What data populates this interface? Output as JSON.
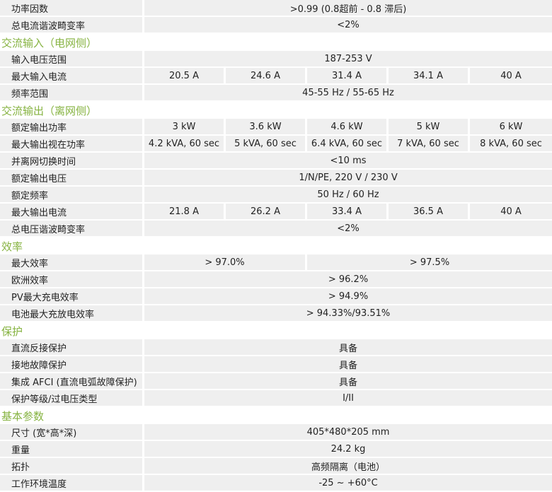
{
  "rows": [
    {
      "type": "row",
      "label": "功率因数",
      "values": [
        ">0.99 (0.8超前 - 0.8 滞后)"
      ]
    },
    {
      "type": "row",
      "label": "总电流谐波畸变率",
      "values": [
        "<2%"
      ]
    },
    {
      "type": "section",
      "title": "交流输入（电网侧）"
    },
    {
      "type": "row",
      "label": "输入电压范围",
      "values": [
        "187-253 V"
      ]
    },
    {
      "type": "row",
      "label": "最大输入电流",
      "values": [
        "20.5 A",
        "24.6 A",
        "31.4 A",
        "34.1 A",
        "40 A"
      ]
    },
    {
      "type": "row",
      "label": "频率范围",
      "values": [
        "45-55 Hz / 55-65 Hz"
      ]
    },
    {
      "type": "section",
      "title": "交流输出（离网侧）"
    },
    {
      "type": "row",
      "label": "额定输出功率",
      "values": [
        "3 kW",
        "3.6 kW",
        "4.6 kW",
        "5 kW",
        "6 kW"
      ]
    },
    {
      "type": "row",
      "label": "最大输出视在功率",
      "values": [
        "4.2 kVA, 60 sec",
        "5 kVA, 60 sec",
        "6.4 kVA, 60 sec",
        "7 kVA, 60 sec",
        "8 kVA, 60 sec"
      ]
    },
    {
      "type": "row",
      "label": "并离网切换时间",
      "values": [
        "<10 ms"
      ]
    },
    {
      "type": "row",
      "label": "额定输出电压",
      "values": [
        "1/N/PE, 220 V / 230 V"
      ]
    },
    {
      "type": "row",
      "label": "额定频率",
      "values": [
        "50 Hz / 60 Hz"
      ]
    },
    {
      "type": "row",
      "label": "最大输出电流",
      "values": [
        "21.8 A",
        "26.2 A",
        "33.4 A",
        "36.5 A",
        "40 A"
      ]
    },
    {
      "type": "row",
      "label": "总电压谐波畸变率",
      "values": [
        "<2%"
      ]
    },
    {
      "type": "section",
      "title": "效率"
    },
    {
      "type": "row",
      "label": "最大效率",
      "values": [
        "> 97.0%",
        "> 97.5%"
      ]
    },
    {
      "type": "row",
      "label": "欧洲效率",
      "values": [
        "> 96.2%"
      ]
    },
    {
      "type": "row",
      "label": "PV最大充电效率",
      "values": [
        "> 94.9%"
      ]
    },
    {
      "type": "row",
      "label": "电池最大充放电效率",
      "values": [
        "> 94.33%/93.51%"
      ]
    },
    {
      "type": "section",
      "title": "保护"
    },
    {
      "type": "row",
      "label": "直流反接保护",
      "values": [
        "具备"
      ]
    },
    {
      "type": "row",
      "label": "接地故障保护",
      "values": [
        "具备"
      ]
    },
    {
      "type": "row",
      "label": "集成 AFCI (直流电弧故障保护)",
      "values": [
        "具备"
      ]
    },
    {
      "type": "row",
      "label": "保护等级/过电压类型",
      "values": [
        "I/II"
      ]
    },
    {
      "type": "section",
      "title": "基本参数"
    },
    {
      "type": "row",
      "label": "尺寸 (宽*高*深)",
      "values": [
        "405*480*205 mm"
      ]
    },
    {
      "type": "row",
      "label": "重量",
      "values": [
        "24.2 kg"
      ]
    },
    {
      "type": "row",
      "label": "拓扑",
      "values": [
        "高频隔离（电池）"
      ]
    },
    {
      "type": "row",
      "label": "工作环境温度",
      "values": [
        "-25 ~ +60°C"
      ]
    }
  ]
}
